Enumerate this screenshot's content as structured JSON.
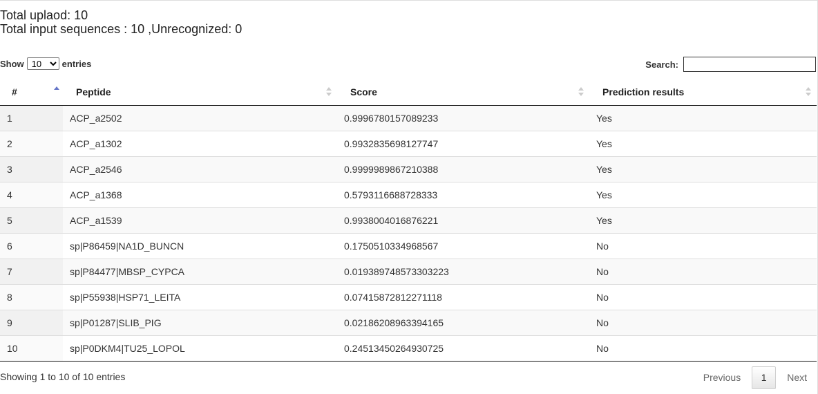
{
  "header": {
    "top_text": "Total uplaod: 10",
    "input_summary": "Total input sequences : 10 ,Unrecognized: 0",
    "cut_text": "                  ,                        "
  },
  "length_control": {
    "show_label": "Show",
    "selected": "10",
    "entries_label": "entries"
  },
  "search": {
    "label": "Search:",
    "value": ""
  },
  "table": {
    "columns": [
      "#",
      "Peptide",
      "Score",
      "Prediction results"
    ],
    "sorted_column": "#",
    "rows": [
      {
        "n": "1",
        "peptide": "ACP_a2502",
        "score": "0.9996780157089233",
        "result": "Yes"
      },
      {
        "n": "2",
        "peptide": "ACP_a1302",
        "score": "0.9932835698127747",
        "result": "Yes"
      },
      {
        "n": "3",
        "peptide": "ACP_a2546",
        "score": "0.9999989867210388",
        "result": "Yes"
      },
      {
        "n": "4",
        "peptide": "ACP_a1368",
        "score": "0.5793116688728333",
        "result": "Yes"
      },
      {
        "n": "5",
        "peptide": "ACP_a1539",
        "score": "0.9938004016876221",
        "result": "Yes"
      },
      {
        "n": "6",
        "peptide": "sp|P86459|NA1D_BUNCN",
        "score": "0.1750510334968567",
        "result": "No"
      },
      {
        "n": "7",
        "peptide": "sp|P84477|MBSP_CYPCA",
        "score": "0.019389748573303223",
        "result": "No"
      },
      {
        "n": "8",
        "peptide": "sp|P55938|HSP71_LEITA",
        "score": "0.07415872812271118",
        "result": "No"
      },
      {
        "n": "9",
        "peptide": "sp|P01287|SLIB_PIG",
        "score": "0.02186208963394165",
        "result": "No"
      },
      {
        "n": "10",
        "peptide": "sp|P0DKM4|TU25_LOPOL",
        "score": "0.24513450264930725",
        "result": "No"
      }
    ]
  },
  "footer": {
    "summary": "Showing 1 to 10 of 10 entries",
    "previous_label": "Previous",
    "current_page": "1",
    "next_label": "Next"
  }
}
